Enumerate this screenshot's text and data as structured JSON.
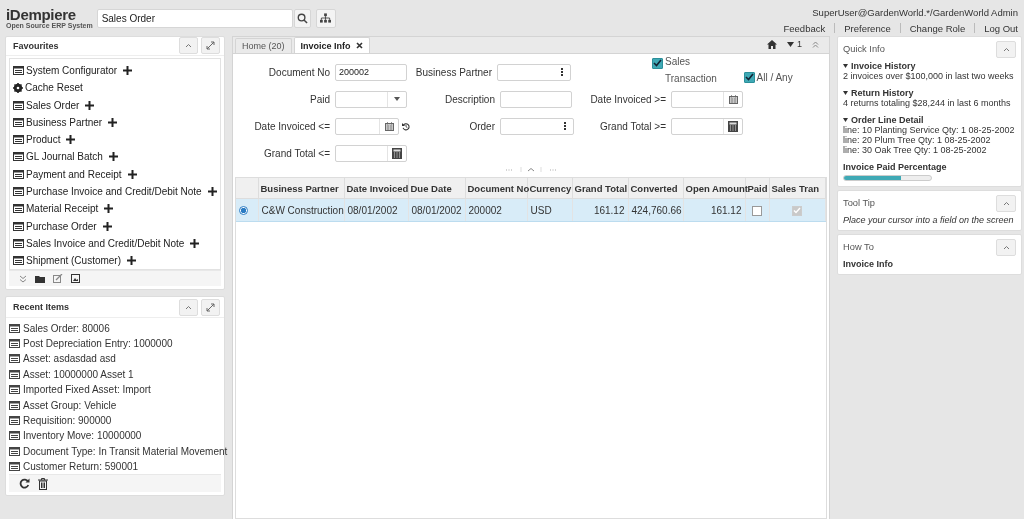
{
  "header": {
    "logo": "iDempiere",
    "logo_tagline": "Open Source ERP System",
    "search": {
      "value": "Sales Order"
    },
    "user": "SuperUser@GardenWorld.*/GardenWorld Admin",
    "links": [
      "Feedback",
      "Preference",
      "Change Role",
      "Log Out"
    ]
  },
  "favourites": {
    "title": "Favourites",
    "items": [
      {
        "label": "System Configurator",
        "kind": "window"
      },
      {
        "label": "Cache Reset",
        "kind": "process"
      },
      {
        "label": "Sales Order",
        "kind": "window"
      },
      {
        "label": "Business Partner",
        "kind": "window"
      },
      {
        "label": "Product",
        "kind": "window"
      },
      {
        "label": "GL Journal Batch",
        "kind": "window"
      },
      {
        "label": "Payment and Receipt",
        "kind": "window"
      },
      {
        "label": "Purchase Invoice and Credit/Debit Note",
        "kind": "window"
      },
      {
        "label": "Material Receipt",
        "kind": "window"
      },
      {
        "label": "Purchase Order",
        "kind": "window"
      },
      {
        "label": "Sales Invoice and Credit/Debit Note",
        "kind": "window"
      },
      {
        "label": "Shipment (Customer)",
        "kind": "window"
      }
    ]
  },
  "recent_items": {
    "title": "Recent Items",
    "items": [
      "Sales Order: 80006",
      "Post Depreciation Entry: 1000000",
      "Asset: asdasdad asd",
      "Asset: 10000000 Asset 1",
      "Imported Fixed Asset: Import",
      "Asset Group: Vehicle",
      "Requisition: 900000",
      "Inventory Move: 10000000",
      "Document Type: In Transit Material Movement",
      "Customer Return: 590001"
    ]
  },
  "tabs": [
    {
      "label": "Home (20)",
      "selected": false,
      "closable": false
    },
    {
      "label": "Invoice Info",
      "selected": true,
      "closable": true
    }
  ],
  "tab_toolbar": {
    "count": "1"
  },
  "form": {
    "rows": [
      [
        {
          "label": "Document No",
          "kind": "text",
          "value": "200002"
        },
        {
          "label": "Business Partner",
          "kind": "search"
        },
        {
          "label": "Sales Transaction",
          "kind": "checkbox",
          "checked": true
        },
        {
          "label": "All / Any",
          "kind": "checkbox",
          "checked": true
        }
      ],
      [
        {
          "label": "Paid",
          "kind": "select"
        },
        {
          "label": "Description",
          "kind": "text"
        },
        {
          "label": "Date Invoiced >=",
          "kind": "date"
        }
      ],
      [
        {
          "label": "Date Invoiced <=",
          "kind": "date_reset"
        },
        {
          "label": "Order",
          "kind": "search"
        },
        {
          "label": "Grand Total >=",
          "kind": "number"
        }
      ],
      [
        {
          "label": "Grand Total <=",
          "kind": "number"
        }
      ]
    ]
  },
  "table": {
    "columns": [
      "Business Partner",
      "Date Invoiced",
      "Due Date",
      "Document No",
      "Currency",
      "Grand Total",
      "Converted",
      "Open Amount",
      "Paid",
      "Sales Tran"
    ],
    "rows": [
      {
        "selected": true,
        "cells": [
          "C&W Construction",
          "08/01/2002",
          "08/01/2002",
          "200002",
          "USD",
          "161.12",
          "424,760.66",
          "161.12"
        ],
        "paid": false,
        "sales_transaction": true
      }
    ]
  },
  "quick_info": {
    "title": "Quick Info",
    "sections": [
      {
        "title": "Invoice History",
        "lines": [
          "2 invoices over $100,000 in last two weeks"
        ]
      },
      {
        "title": "Return History",
        "lines": [
          "4 returns totaling $28,244 in last 6 months"
        ]
      },
      {
        "title": "Order Line Detail",
        "lines": [
          "line: 10 Planting Service Qty: 1 08-25-2002",
          "line: 20 Plum Tree Qty: 1 08-25-2002",
          "line: 30 Oak Tree Qty: 1 08-25-2002"
        ]
      }
    ],
    "paid_percentage": {
      "label": "Invoice Paid Percentage",
      "level": 0.66
    }
  },
  "tool_tip": {
    "title": "Tool Tip",
    "text": "Place your cursor into a field on the screen"
  },
  "how_to": {
    "title": "How To",
    "text": "Invoice Info"
  }
}
